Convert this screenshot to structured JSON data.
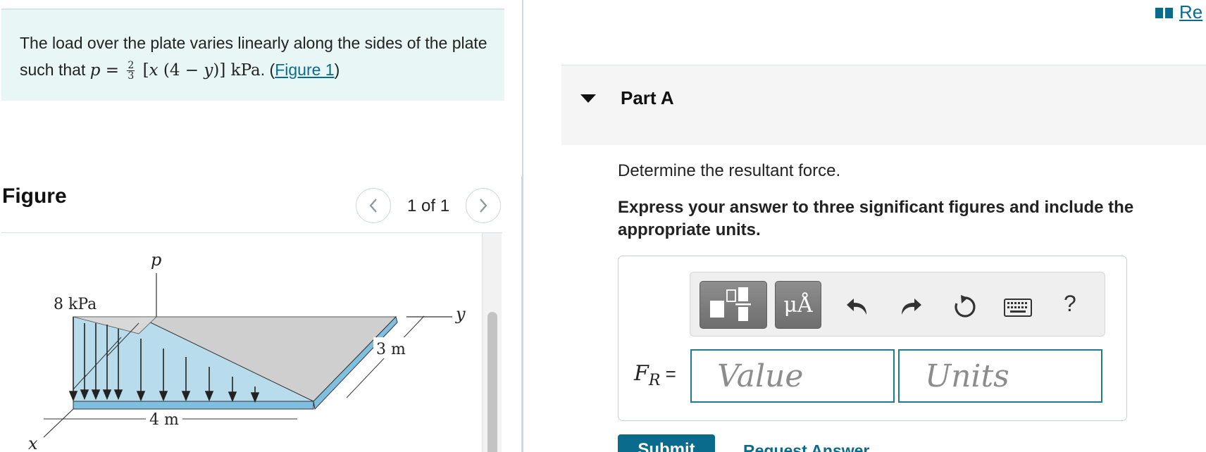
{
  "problem": {
    "text_before": "The load over the plate varies linearly along the sides of the plate such that ",
    "formula_p": "p",
    "formula_eq": " = ",
    "formula_num": "2",
    "formula_den": "3",
    "formula_body_open": " [",
    "formula_x": "x",
    "formula_paren": " (4 − ",
    "formula_y": "y",
    "formula_close": ")] ",
    "formula_unit": "kPa",
    "text_after": ". (",
    "figure_link": "Figure 1",
    "text_end": ")"
  },
  "figure": {
    "title": "Figure",
    "page_count": "1 of 1",
    "labels": {
      "p": "p",
      "load": "8 kPa",
      "y": "y",
      "x": "x",
      "width": "3 m",
      "length": "4 m"
    }
  },
  "header": {
    "review_label": "Re"
  },
  "part": {
    "title": "Part A",
    "question": "Determine the resultant force.",
    "instruction": "Express your answer to three significant figures and include the appropriate units."
  },
  "answer": {
    "label_main": "F",
    "label_sub": "R",
    "label_eq": " =",
    "value_placeholder": "Value",
    "units_placeholder": "Units",
    "value": "",
    "units": ""
  },
  "toolbar": {
    "units_btn": "μÅ",
    "help": "?"
  },
  "actions": {
    "submit": "Submit",
    "request": "Request Answer"
  },
  "colors": {
    "accent": "#0b6b8c",
    "problem_bg": "#e8f6f6",
    "plate_blue": "#b8dcec",
    "plate_gray": "#cfcfcf"
  }
}
